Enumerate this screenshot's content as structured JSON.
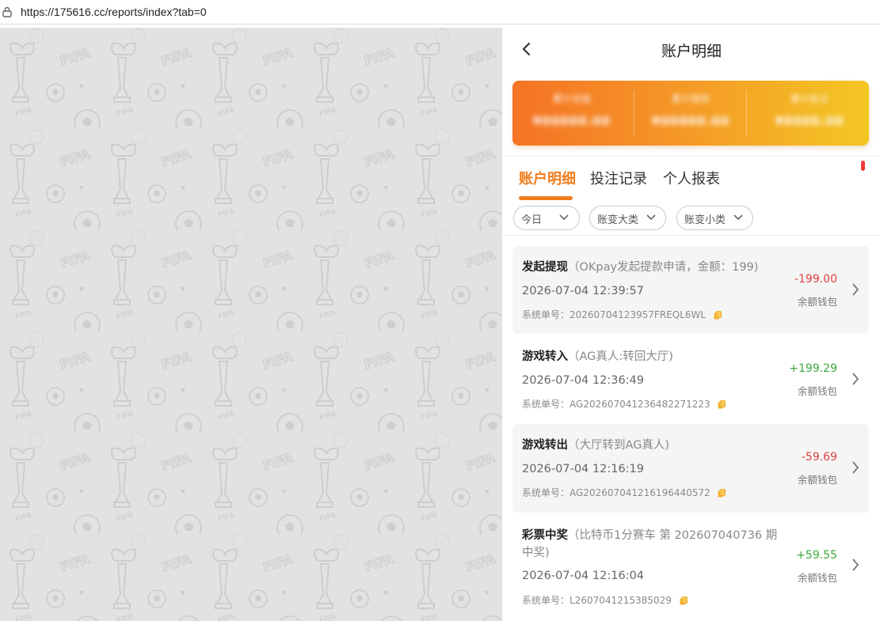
{
  "browser": {
    "url": "https://175616.cc/reports/index?tab=0"
  },
  "nav": {
    "title": "账户明细"
  },
  "summary": {
    "stats": [
      {
        "label": "累计充值",
        "value": "¥00000.00"
      },
      {
        "label": "累计提现",
        "value": "¥00000.00"
      },
      {
        "label": "累计投注",
        "value": "¥0000.00"
      }
    ]
  },
  "tabs": [
    {
      "label": "账户明细",
      "active": true
    },
    {
      "label": "投注记录",
      "active": false
    },
    {
      "label": "个人报表",
      "active": false
    }
  ],
  "filters": [
    {
      "label": "今日"
    },
    {
      "label": "账变大类"
    },
    {
      "label": "账变小类"
    }
  ],
  "records": [
    {
      "type": "发起提现",
      "detail": "（OKpay发起提款申请，金额：199)",
      "time": "2026-07-04 12:39:57",
      "order_label": "系统单号：",
      "order_no": "20260704123957FREQL6WL",
      "amount": "-199.00",
      "wallet": "余额钱包"
    },
    {
      "type": "游戏转入",
      "detail": "（AG真人:转回大厅)",
      "time": "2026-07-04 12:36:49",
      "order_label": "系统单号：",
      "order_no": "AG202607041236482271223",
      "amount": "+199.29",
      "wallet": "余额钱包"
    },
    {
      "type": "游戏转出",
      "detail": "（大厅转到AG真人)",
      "time": "2026-07-04 12:16:19",
      "order_label": "系统单号：",
      "order_no": "AG202607041216196440572",
      "amount": "-59.69",
      "wallet": "余额钱包"
    },
    {
      "type": "彩票中奖",
      "detail": "（比特币1分赛车 第 202607040736 期 中奖)",
      "time": "2026-07-04 12:16:04",
      "order_label": "系统单号：",
      "order_no": "L2607041215385029",
      "amount": "+59.55",
      "wallet": "余额钱包"
    }
  ],
  "colors": {
    "accent": "#f07d1e",
    "negative": "#e04040",
    "positive": "#3aa83a",
    "banner_start": "#f57325",
    "banner_end": "#f4c724"
  }
}
